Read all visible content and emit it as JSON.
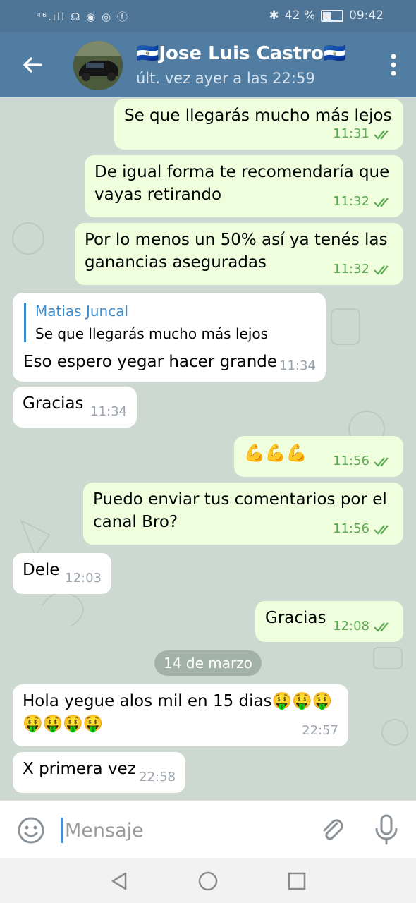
{
  "status_bar": {
    "left_text": "⁴⁶.ıll ☊ ◉ ◎ ⓕ",
    "battery": "42 %",
    "time": "09:42",
    "battery_level": 0.42
  },
  "header": {
    "name": "🇸🇻Jose Luis Castro🇸🇻",
    "last_seen": "últ. vez ayer a las 22:59",
    "icons": [
      "back-arrow-icon",
      "avatar",
      "more-vert-icon"
    ]
  },
  "messages": [
    {
      "dir": "out",
      "text": "Se que llegarás mucho más lejos",
      "time": "11:31"
    },
    {
      "dir": "out",
      "text": "De igual forma te recomendaría que vayas retirando",
      "time": "11:32"
    },
    {
      "dir": "out",
      "text": "Por lo menos un 50% así ya tenés las ganancias aseguradas",
      "time": "11:32"
    },
    {
      "dir": "in",
      "reply_name": "Matias Juncal",
      "reply_text": "Se que llegarás mucho más lejos",
      "text": "Eso espero yegar hacer grande",
      "time": "11:34"
    },
    {
      "dir": "in",
      "text": "Gracias",
      "time": "11:34"
    },
    {
      "dir": "out",
      "text": "💪💪💪",
      "time": "11:56"
    },
    {
      "dir": "out",
      "text": "Puedo enviar tus comentarios por el canal Bro?",
      "time": "11:56"
    },
    {
      "dir": "in",
      "text": "Dele",
      "time": "12:03"
    },
    {
      "dir": "out",
      "text": "Gracias",
      "time": "12:08"
    },
    {
      "dir": "in",
      "text": "Hola yegue alos mil en 15 dias🤑🤑🤑🤑🤑🤑🤑",
      "time": "22:57"
    },
    {
      "dir": "in",
      "text": "X primera vez",
      "time": "22:58"
    }
  ],
  "date_separator": "14 de marzo",
  "input": {
    "placeholder": "Mensaje",
    "icons": [
      "emoji-icon",
      "attach-icon",
      "mic-icon"
    ]
  },
  "colors": {
    "header": "#527da3",
    "outgoing_bubble": "#efffde",
    "incoming_bubble": "#ffffff",
    "accent": "#3d8ed1",
    "check": "#5eaa54"
  }
}
